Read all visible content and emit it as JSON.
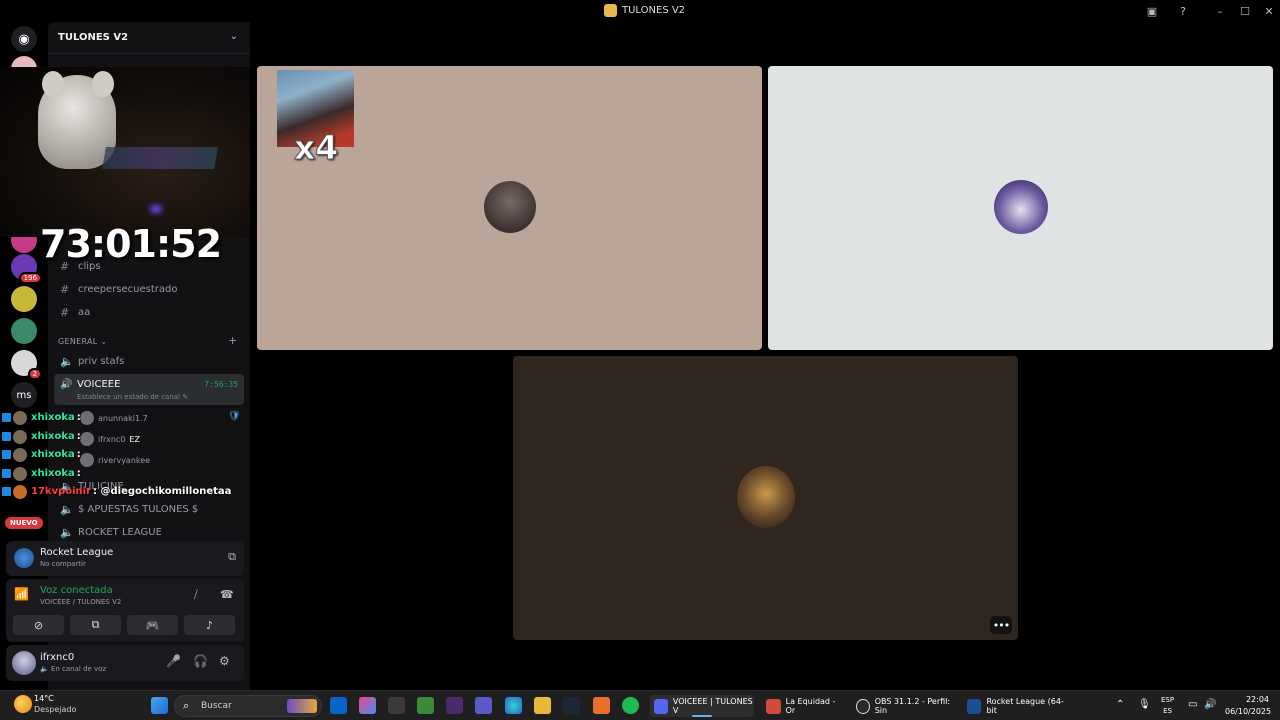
{
  "window": {
    "title": "TULONES V2",
    "inbox_icon": "inbox-icon",
    "help_icon": "help-icon",
    "minimize": "–",
    "maximize": "☐",
    "close": "✕"
  },
  "servers": {
    "nuevo_badge": "NUEVO",
    "badge_196": "196",
    "badge_2": "2",
    "ms_label": "ms"
  },
  "guild": {
    "name": "TULONES V2",
    "chevron": "⌄"
  },
  "channels": [
    {
      "name": "clips",
      "icon": "#"
    },
    {
      "name": "creepersecuestrado",
      "icon": "#"
    },
    {
      "name": "aa",
      "icon": "#"
    }
  ],
  "category": {
    "name": "GENERAL ⌄",
    "add": "+"
  },
  "voice_channels": {
    "priv": "priv stafs",
    "active": {
      "name": "VOICEEE",
      "time": "7:56:35",
      "status": "Establece un estado de canal ✎"
    },
    "apuestas": "$ APUESTAS TULONES $",
    "rocket": "ROCKET LEAGUE",
    "tulicine": "TULICINE"
  },
  "voice_members": [
    {
      "name": "anunnaki1.7"
    },
    {
      "name": "ifrxnc0",
      "tag": "EZ"
    },
    {
      "name": "rivervyankee"
    }
  ],
  "stream_overlay": {
    "timer": "73:01:52",
    "x4": "x4"
  },
  "chat": [
    {
      "user": "xhixoka",
      "msg": ":"
    },
    {
      "user": "xhixoka",
      "msg": ":"
    },
    {
      "user": "xhixoka",
      "msg": ":"
    },
    {
      "user": "xhixoka",
      "msg": ":"
    },
    {
      "user": "17kvpoinir",
      "msg": ": @diegochikomillonetaa"
    }
  ],
  "activity": {
    "game": "Rocket League",
    "sub": "No compartir"
  },
  "voice": {
    "title": "Voz conectada",
    "sub": "VOICEEE / TULONES V2"
  },
  "user": {
    "name": "ifrxnc0",
    "status": "En canal de voz"
  },
  "taskbar": {
    "temp": "14°C",
    "cond": "Despejado",
    "search": "Buscar",
    "apps": [
      {
        "label": "VOICEEE | TULONES V",
        "color": "#5865f2"
      },
      {
        "label": "La Equidad - Or",
        "color": "#d04a3a"
      },
      {
        "label": "OBS 31.1.2 - Perfil: Sin",
        "color": "#2a2a2a"
      },
      {
        "label": "Rocket League (64-bit",
        "color": "#1c4f8f"
      }
    ],
    "lang1": "ESP",
    "lang2": "ES",
    "time": "22:04",
    "date": "06/10/2025"
  },
  "colors": {
    "accent": "#5865f2",
    "voice_green": "#23a55a",
    "tile1": "#bba498",
    "tile2": "#dfe3e3",
    "tile3": "#2f2620"
  }
}
